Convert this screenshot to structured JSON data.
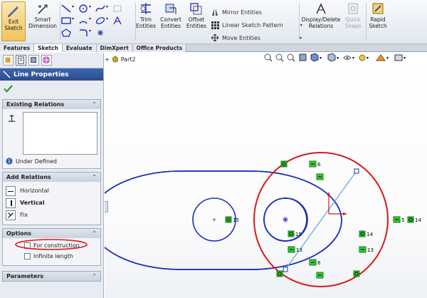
{
  "ribbon": {
    "exit_sketch": "Exit\nSketch",
    "smart_dimension": "Smart\nDimension",
    "trim_entities": "Trim\nEntities",
    "convert_entities": "Convert\nEntities",
    "offset_entities": "Offset\nEntities",
    "mirror_entities": "Mirror Entities",
    "linear_sketch_pattern": "Linear Sketch Pattern",
    "move_entities": "Move Entities",
    "display_delete_relations": "Display/Delete\nRelations",
    "quick_snaps": "Quick\nSnaps",
    "rapid_sketch": "Rapid\nSketch"
  },
  "tabs": [
    "Features",
    "Sketch",
    "Evaluate",
    "DimXpert",
    "Office Products"
  ],
  "active_tab": "Sketch",
  "panel": {
    "title": "Line Properties",
    "existing_relations": "Existing Relations",
    "under_defined": "Under Defined",
    "add_relations": "Add Relations",
    "relations": [
      "Horizontal",
      "Vertical",
      "Fix"
    ],
    "options": "Options",
    "for_construction": "For construction",
    "infinite_length": "Infinite length",
    "parameters": "Parameters"
  },
  "graphics": {
    "tree_item": "Part2",
    "relation_tags": [
      "6",
      "15",
      "15",
      "13",
      "6",
      "13",
      "14",
      "5",
      "14"
    ]
  },
  "colors": {
    "sketch_blue": "#1f2fb8",
    "highlight_red": "#d81818",
    "selection_cyan": "#55a7e6",
    "relation_green": "#33cc33"
  }
}
